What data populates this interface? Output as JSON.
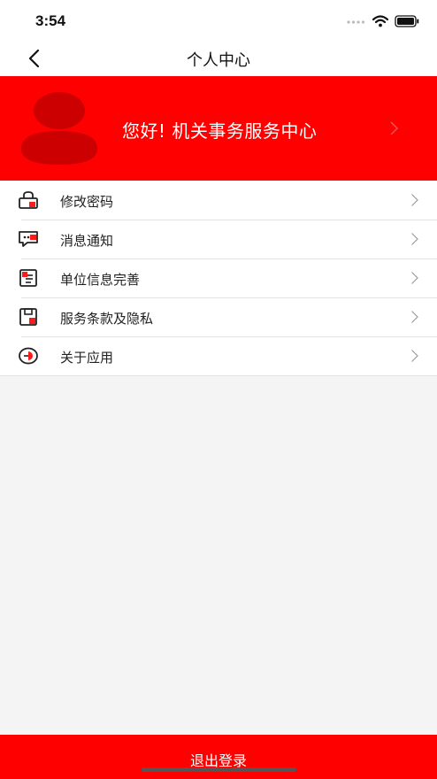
{
  "status_bar": {
    "time": "3:54"
  },
  "nav": {
    "title": "个人中心"
  },
  "profile": {
    "greeting": "您好! 机关事务服务中心"
  },
  "menu": {
    "items": [
      {
        "label": "修改密码",
        "icon": "lock-icon"
      },
      {
        "label": "消息通知",
        "icon": "message-icon"
      },
      {
        "label": "单位信息完善",
        "icon": "document-icon"
      },
      {
        "label": "服务条款及隐私",
        "icon": "save-icon"
      },
      {
        "label": "关于应用",
        "icon": "clock-icon"
      }
    ]
  },
  "logout": {
    "label": "退出登录"
  },
  "colors": {
    "brand_red": "#ff0000",
    "background": "#f4f4f4",
    "divider": "#e2e2e2"
  }
}
